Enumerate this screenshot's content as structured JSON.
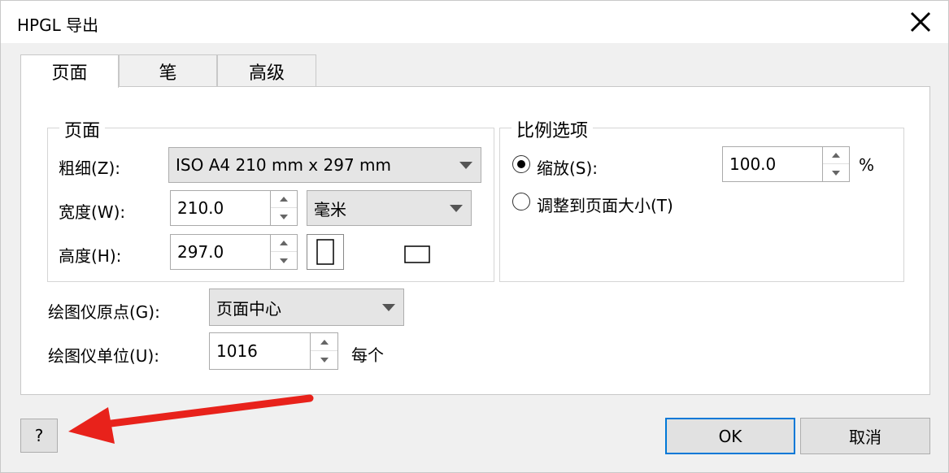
{
  "window": {
    "title": "HPGL 导出"
  },
  "tabs": [
    {
      "label": "页面",
      "active": true
    },
    {
      "label": "笔",
      "active": false
    },
    {
      "label": "高级",
      "active": false
    }
  ],
  "page_group": {
    "legend": "页面",
    "size_label": "粗细(Z):",
    "size_value": "ISO A4 210 mm x 297 mm",
    "width_label": "宽度(W):",
    "width_value": "210.0",
    "unit_value": "毫米",
    "height_label": "高度(H):",
    "height_value": "297.0",
    "orientation": "portrait"
  },
  "scale_group": {
    "legend": "比例选项",
    "scale_label": "缩放(S):",
    "scale_value": "100.0",
    "scale_unit": "%",
    "fit_label": "调整到页面大小(T)",
    "selected": "scale"
  },
  "plotter": {
    "origin_label": "绘图仪原点(G):",
    "origin_value": "页面中心",
    "units_label": "绘图仪单位(U):",
    "units_value": "1016",
    "units_suffix": "每个"
  },
  "buttons": {
    "help": "?",
    "ok": "OK",
    "cancel": "取消"
  },
  "colors": {
    "accent": "#0078d7",
    "arrow": "#e8221b"
  }
}
